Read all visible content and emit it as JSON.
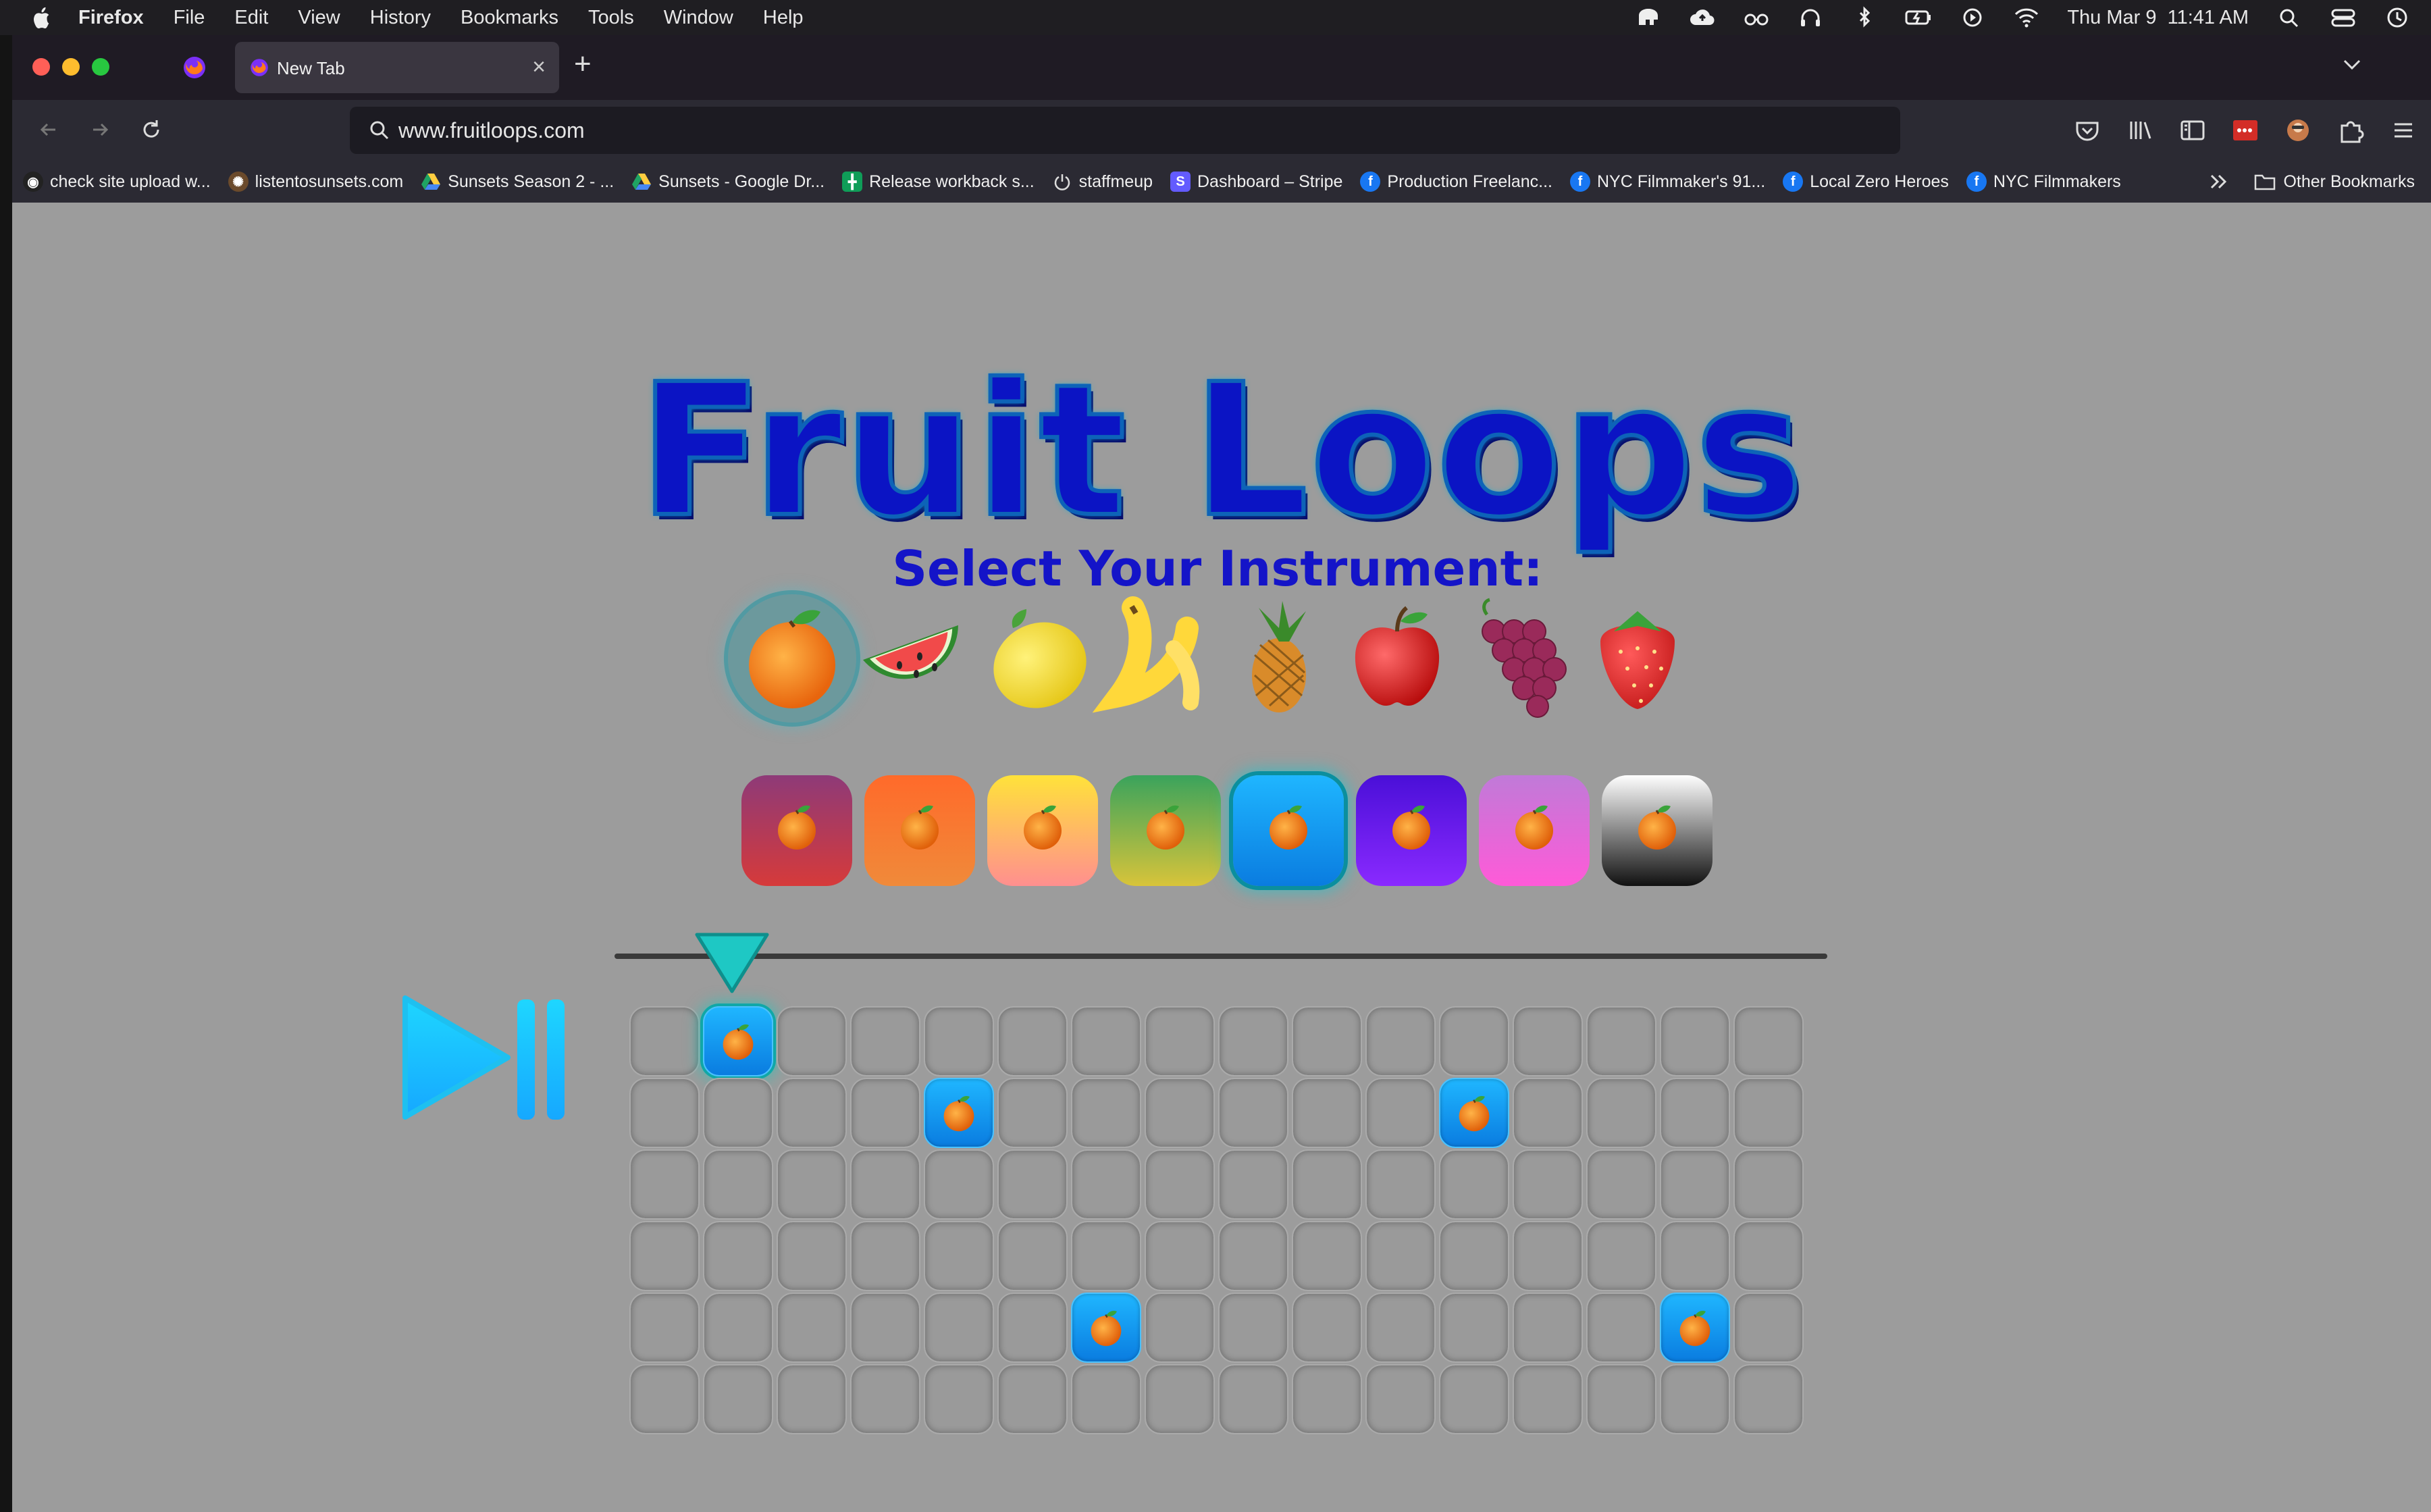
{
  "menubar": {
    "app_name": "Firefox",
    "menus": [
      "File",
      "Edit",
      "View",
      "History",
      "Bookmarks",
      "Tools",
      "Window",
      "Help"
    ],
    "clock": "Thu Mar 9  11:41 AM"
  },
  "browser": {
    "tab_title": "New Tab",
    "url": "www.fruitloops.com",
    "bookmarks": [
      {
        "label": "check site upload w...",
        "icon": "github-icon",
        "color": "#222222"
      },
      {
        "label": "listentosunsets.com",
        "icon": "site-icon",
        "color": "#6b4a2b"
      },
      {
        "label": "Sunsets Season 2 - ...",
        "icon": "google-drive-icon",
        "color": "#1fa463"
      },
      {
        "label": "Sunsets - Google Dr...",
        "icon": "google-drive-icon",
        "color": "#1fa463"
      },
      {
        "label": "Release workback s...",
        "icon": "google-sheets-icon",
        "color": "#0f9d58"
      },
      {
        "label": "staffmeup",
        "icon": "power-icon",
        "color": "#3a3a3a"
      },
      {
        "label": "Dashboard – Stripe",
        "icon": "stripe-icon",
        "color": "#635bff"
      },
      {
        "label": "Production Freelanc...",
        "icon": "facebook-icon",
        "color": "#1877f2"
      },
      {
        "label": "NYC Filmmaker's 91...",
        "icon": "facebook-icon",
        "color": "#1877f2"
      },
      {
        "label": "Local Zero Heroes",
        "icon": "facebook-icon",
        "color": "#1877f2"
      },
      {
        "label": "NYC Filmmakers",
        "icon": "facebook-icon",
        "color": "#1877f2"
      }
    ],
    "other_bookmarks": "Other Bookmarks"
  },
  "page": {
    "title": "Fruit Loops",
    "subtitle": "Select Your Instrument:",
    "instruments": [
      {
        "name": "orange-icon",
        "selected": true
      },
      {
        "name": "watermelon-icon",
        "selected": false
      },
      {
        "name": "lemon-icon",
        "selected": false
      },
      {
        "name": "banana-icon",
        "selected": false
      },
      {
        "name": "pineapple-icon",
        "selected": false
      },
      {
        "name": "apple-icon",
        "selected": false
      },
      {
        "name": "grapes-icon",
        "selected": false
      },
      {
        "name": "strawberry-icon",
        "selected": false
      }
    ],
    "colors": [
      {
        "name": "crimson",
        "gradient": [
          "#8e3a78",
          "#d63a3a"
        ],
        "selected": false
      },
      {
        "name": "orange",
        "gradient": [
          "#ff6a2a",
          "#f08a3a"
        ],
        "selected": false
      },
      {
        "name": "yellow",
        "gradient": [
          "#ffe23a",
          "#ff8f8f"
        ],
        "selected": false
      },
      {
        "name": "green",
        "gradient": [
          "#3aa35c",
          "#d8c43a"
        ],
        "selected": false
      },
      {
        "name": "blue",
        "gradient": [
          "#1fb6ff",
          "#0a7ce0"
        ],
        "selected": true
      },
      {
        "name": "purple",
        "gradient": [
          "#4a0fd8",
          "#8a2aff"
        ],
        "selected": false
      },
      {
        "name": "pink",
        "gradient": [
          "#c07ad8",
          "#ff5ad8"
        ],
        "selected": false
      },
      {
        "name": "mono",
        "gradient": [
          "#ffffff",
          "#111111"
        ],
        "selected": false
      }
    ],
    "sequencer": {
      "rows": 6,
      "columns": 16,
      "playhead_step": 2,
      "active_cells": [
        [
          1,
          2
        ],
        [
          2,
          5
        ],
        [
          2,
          12
        ],
        [
          5,
          7
        ],
        [
          5,
          15
        ]
      ]
    }
  }
}
